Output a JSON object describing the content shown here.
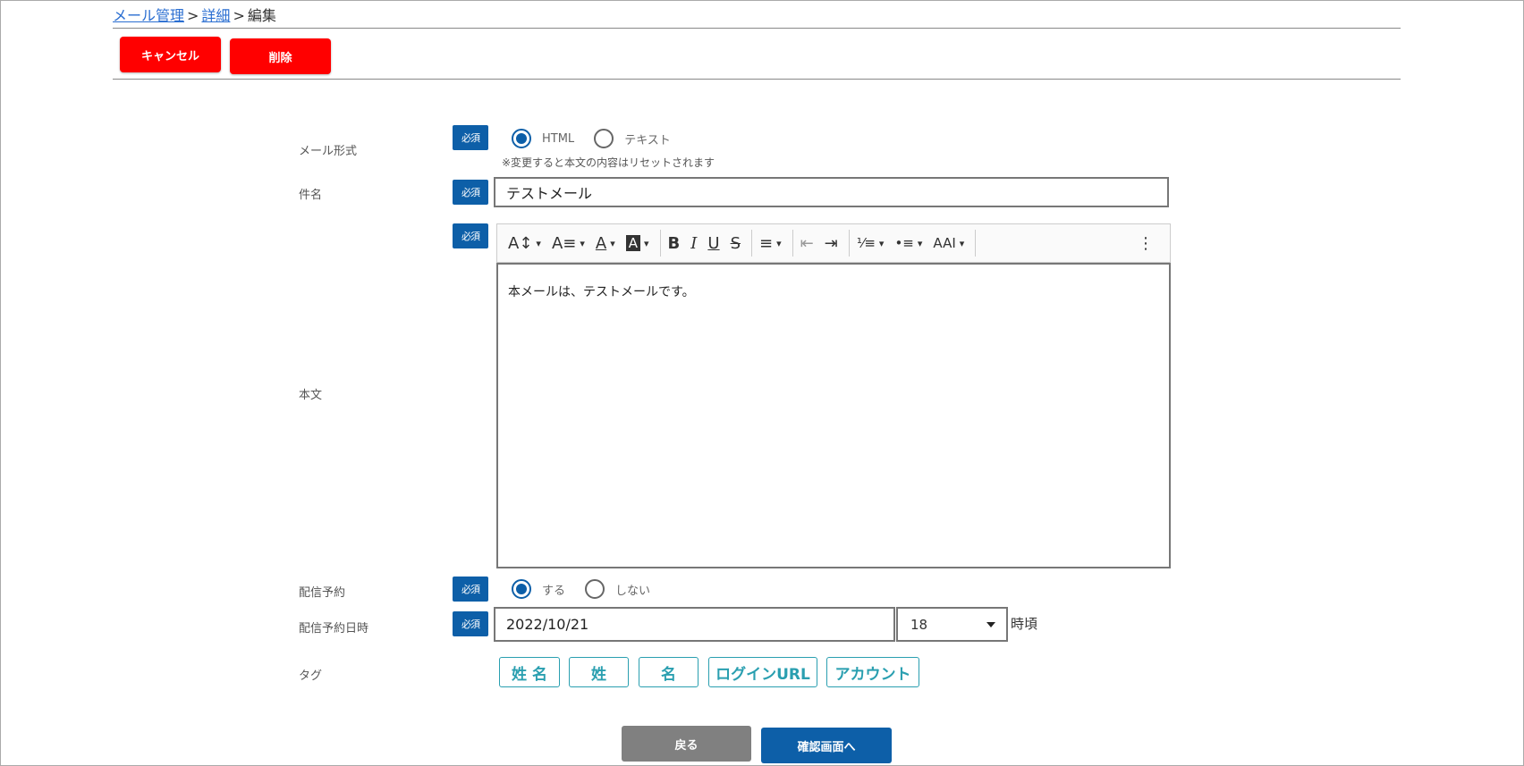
{
  "breadcrumb": {
    "item1": "メール管理",
    "item2": "詳細",
    "current": "編集",
    "sep": ">"
  },
  "actions": {
    "cancel": "キャンセル",
    "delete": "削除"
  },
  "required_badge": "必須",
  "form": {
    "mail_format": {
      "label": "メール形式",
      "options": [
        "HTML",
        "テキスト"
      ],
      "selected": "HTML",
      "note": "※変更すると本文の内容はリセットされます"
    },
    "subject": {
      "label": "件名",
      "value": "テストメール"
    },
    "body": {
      "label": "本文",
      "value": "本メールは、テストメールです。"
    },
    "schedule": {
      "label": "配信予約",
      "options": [
        "する",
        "しない"
      ],
      "selected": "する"
    },
    "schedule_datetime": {
      "label": "配信予約日時",
      "date": "2022/10/21",
      "hour": "18",
      "suffix": "時頃"
    },
    "tags": {
      "label": "タグ",
      "items": [
        "姓 名",
        "姓",
        "名",
        "ログインURL",
        "アカウント"
      ]
    }
  },
  "toolbar": {
    "font_size": "A↕",
    "line_height": "A≡",
    "font_color": "A",
    "bg_color": "A",
    "bold": "B",
    "italic": "I",
    "underline": "U",
    "strike": "S",
    "align": "≡",
    "outdent": "⇤",
    "indent": "⇥",
    "ordered_list": "⅟≡",
    "bullet_list": "•≡",
    "text_transform": "AAI",
    "more": "⋮"
  },
  "footer": {
    "back": "戻る",
    "confirm": "確認画面へ"
  },
  "colors": {
    "primary": "#0d5fa8",
    "danger": "#ff0000",
    "tag": "#2a9fb0",
    "gray_button": "#808080"
  }
}
